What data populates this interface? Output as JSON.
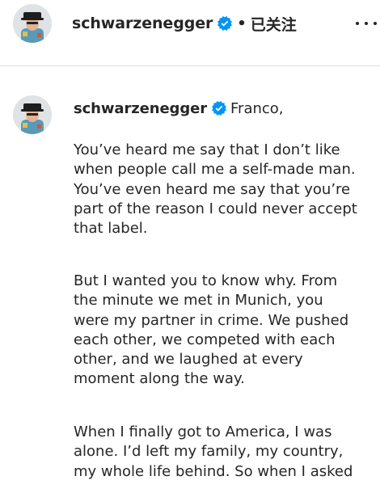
{
  "header": {
    "username": "schwarzenegger",
    "separator": "•",
    "follow_status": "已关注",
    "icons": {
      "avatar": "profile-avatar",
      "verified": "verified-badge-icon",
      "more": "more-options-icon"
    }
  },
  "caption": {
    "username": "schwarzenegger",
    "greeting": "Franco,",
    "paragraphs": [
      {
        "lines": [
          "You’ve heard me say that I don’t like",
          "when people call me a self-made man.",
          "You’ve even heard me say that you’re",
          "part of the reason I could never accept",
          "that label."
        ]
      },
      {
        "lines": [
          "But I wanted you to know why. From",
          "the minute we met in Munich, you",
          "were my partner in crime. We pushed",
          "each other, we competed with each",
          "other, and we laughed at every",
          "moment along the way."
        ]
      },
      {
        "lines": [
          "When I finally got to America, I was",
          "alone. I’d left my family, my country,",
          "my whole life behind. So when I asked"
        ]
      }
    ]
  },
  "colors": {
    "text": "#262626",
    "verified": "#0095f6",
    "divider": "#dbdbdb",
    "background": "#ffffff"
  }
}
